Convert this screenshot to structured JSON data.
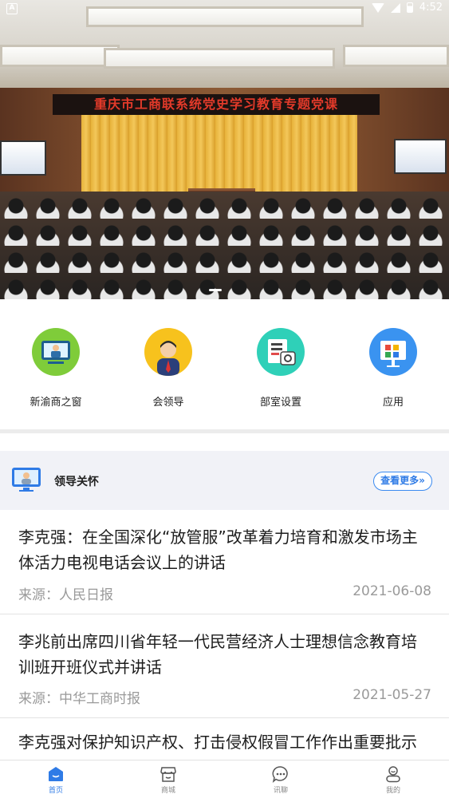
{
  "status_bar": {
    "left_icon": "A",
    "time": "4:52"
  },
  "banner": {
    "stage_text": "重庆市工商联系统党史学习教育专题党课"
  },
  "quick_menu": [
    {
      "label": "新渝商之窗",
      "icon": "monitor-person-icon",
      "color": "#7fcc3a"
    },
    {
      "label": "会领导",
      "icon": "leader-avatar-icon",
      "color": "#f7c21d"
    },
    {
      "label": "部室设置",
      "icon": "department-icon",
      "color": "#2fd0b8"
    },
    {
      "label": "应用",
      "icon": "apps-board-icon",
      "color": "#3a93f0"
    }
  ],
  "section": {
    "title": "领导关怀",
    "more_label": "查看更多»"
  },
  "news": [
    {
      "title": "李克强：在全国深化“放管服”改革着力培育和激发市场主体活力电视电话会议上的讲话",
      "source": "来源：人民日报",
      "date": "2021-06-08"
    },
    {
      "title": "李兆前出席四川省年轻一代民营经济人士理想信念教育培训班开班仪式并讲话",
      "source": "来源：中华工商时报",
      "date": "2021-05-27"
    },
    {
      "title": "李克强对保护知识产权、打击侵权假冒工作作出重要批示",
      "source": "",
      "date": ""
    }
  ],
  "bottom_nav": [
    {
      "label": "首页",
      "icon": "home-icon",
      "active": true
    },
    {
      "label": "商城",
      "icon": "shop-icon",
      "active": false
    },
    {
      "label": "讯聊",
      "icon": "chat-icon",
      "active": false
    },
    {
      "label": "我的",
      "icon": "profile-icon",
      "active": false
    }
  ],
  "colors": {
    "accent": "#2f7be6",
    "section_bg": "#f1f2f7",
    "muted_text": "#9a9a9a"
  }
}
